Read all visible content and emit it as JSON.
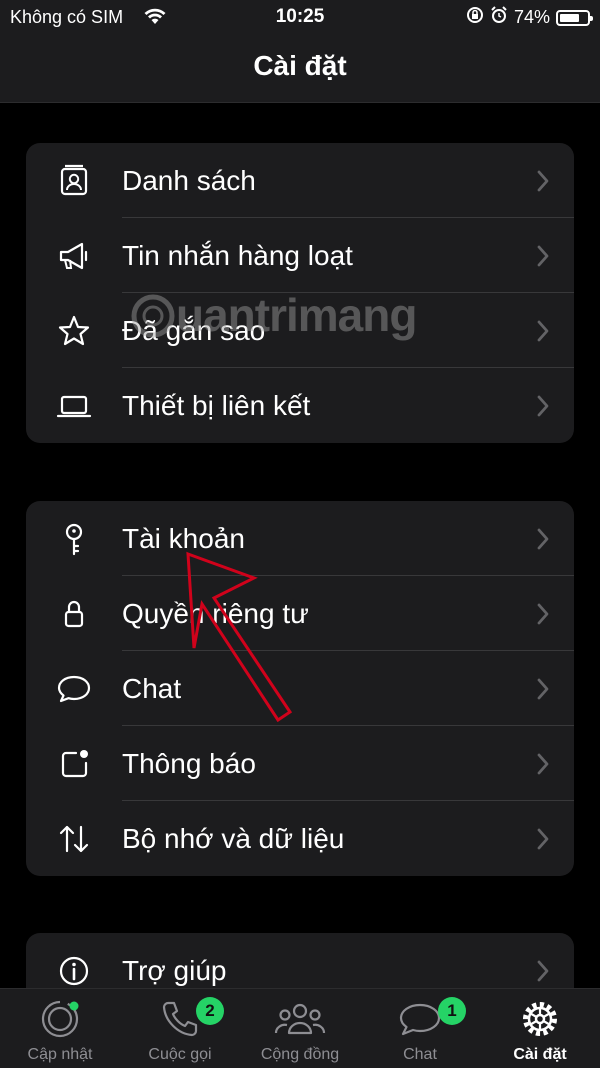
{
  "status_bar": {
    "carrier": "Không có SIM",
    "time": "10:25",
    "battery": "74%",
    "battery_level": 0.74
  },
  "header": {
    "title": "Cài đặt"
  },
  "groups": [
    {
      "items": [
        {
          "label": "Danh sách",
          "icon": "contact-list-icon"
        },
        {
          "label": "Tin nhắn hàng loạt",
          "icon": "megaphone-icon"
        },
        {
          "label": "Đã gắn sao",
          "icon": "star-icon"
        },
        {
          "label": "Thiết bị liên kết",
          "icon": "laptop-icon"
        }
      ]
    },
    {
      "items": [
        {
          "label": "Tài khoản",
          "icon": "key-icon"
        },
        {
          "label": "Quyền riêng tư",
          "icon": "lock-icon"
        },
        {
          "label": "Chat",
          "icon": "chat-bubble-icon"
        },
        {
          "label": "Thông báo",
          "icon": "notification-icon"
        },
        {
          "label": "Bộ nhớ và dữ liệu",
          "icon": "storage-arrows-icon"
        }
      ]
    },
    {
      "items": [
        {
          "label": "Trợ giúp",
          "icon": "info-icon"
        }
      ]
    }
  ],
  "tab_bar": {
    "tabs": [
      {
        "label": "Cập nhật",
        "icon": "status-icon"
      },
      {
        "label": "Cuộc gọi",
        "icon": "phone-icon",
        "badge": "2"
      },
      {
        "label": "Cộng đồng",
        "icon": "community-icon"
      },
      {
        "label": "Chat",
        "icon": "chat-icon",
        "badge": "1"
      },
      {
        "label": "Cài đặt",
        "icon": "settings-gear-icon",
        "active": true
      }
    ]
  },
  "watermark": "uantrimang",
  "colors": {
    "background": "#000000",
    "surface": "#1c1c1e",
    "accent_green": "#25d366",
    "annotation_red": "#d0021b"
  }
}
